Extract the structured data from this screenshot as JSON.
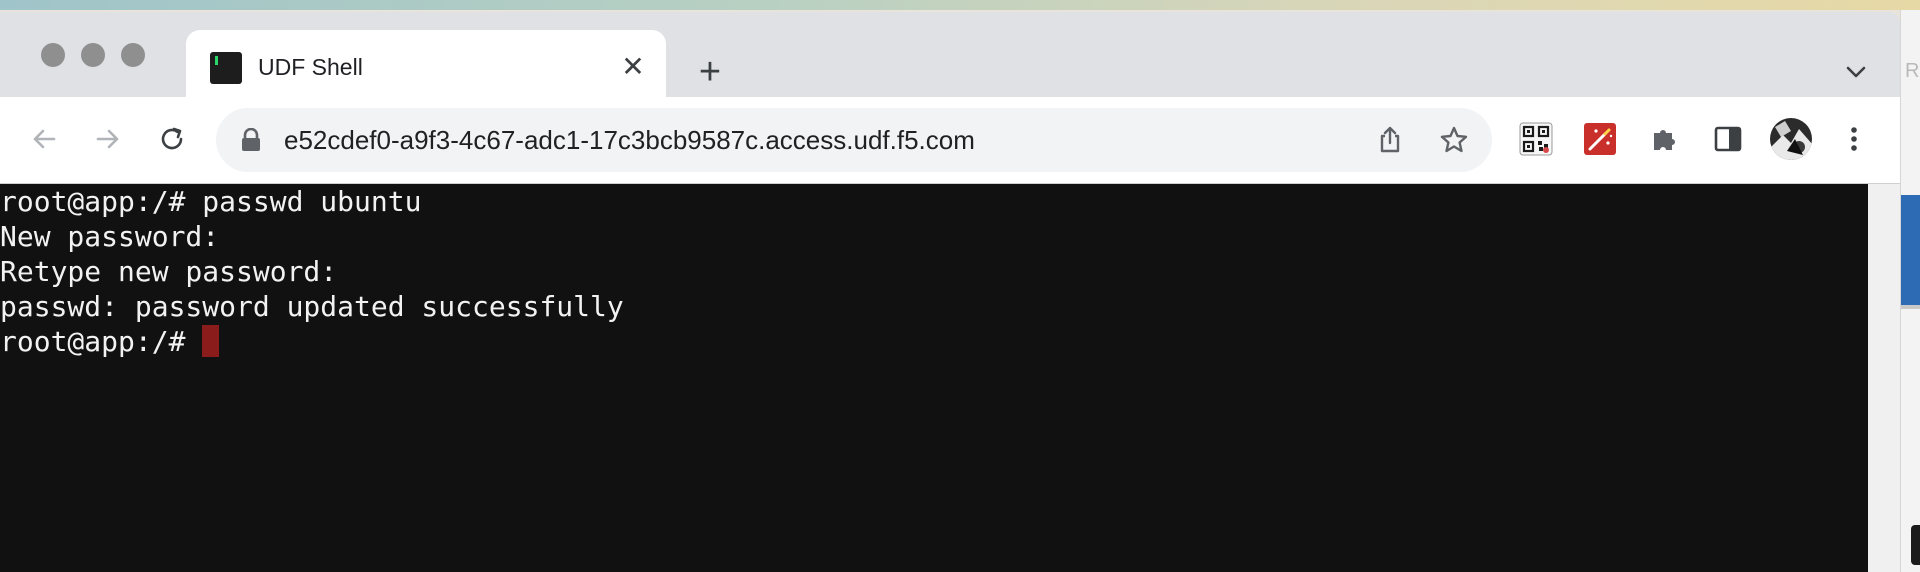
{
  "tab": {
    "title": "UDF Shell",
    "close_glyph": "✕",
    "new_tab_glyph": "+"
  },
  "address_bar": {
    "url": "e52cdef0-a9f3-4c67-adc1-17c3bcb9587c.access.udf.f5.com"
  },
  "terminal": {
    "lines": [
      "root@app:/# passwd ubuntu",
      "New password:",
      "Retype new password:",
      "passwd: password updated successfully",
      "root@app:/# "
    ],
    "cursor_color": "#8a1c1c"
  },
  "background_window": {
    "partial_letter": "R"
  },
  "icons": {
    "back": "arrow-left-icon",
    "forward": "arrow-right-icon",
    "reload": "reload-icon",
    "lock": "lock-icon",
    "share": "share-icon",
    "bookmark": "star-icon",
    "qr": "qr-code-icon",
    "extension_red": "magic-wand-icon",
    "extensions": "puzzle-icon",
    "side_panel": "side-panel-icon",
    "profile": "avatar",
    "menu": "kebab-menu-icon",
    "tab_search": "chevron-down-icon"
  },
  "colors": {
    "terminal_bg": "#111111",
    "terminal_fg": "#f2f2f2",
    "extension_red": "#c9302c"
  }
}
